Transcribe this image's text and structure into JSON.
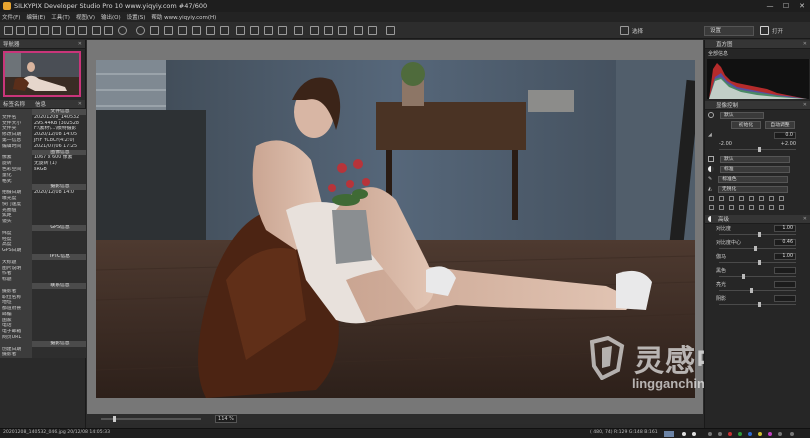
{
  "window": {
    "title": "SILKYPIX Developer Studio Pro 10 www.yiqyiy.com  #47/600",
    "controls": [
      "—",
      "☐",
      "✕"
    ]
  },
  "menu": [
    "文件(F)",
    "编辑(E)",
    "工具(T)",
    "视图(V)",
    "输出(O)",
    "设置(S)",
    "帮助 www.yiqyiy.com(H)"
  ],
  "toolbar": {
    "right_label_1": "选择",
    "right_label_2": "设置",
    "right_label_3": "打开"
  },
  "navigator": {
    "title": "导航器"
  },
  "info": {
    "title_key": "标签名称",
    "title_value": "信息",
    "rows": [
      {
        "k": "",
        "v": "文件信息",
        "sec": true
      },
      {
        "k": "文件名",
        "v": "20201208_140532"
      },
      {
        "k": "文件大小",
        "v": "295.44KB (302528"
      },
      {
        "k": "文件夹",
        "v": "F:\\素材\\...\\模特摄影"
      },
      {
        "k": "修改日期",
        "v": "2020/12/08 14:05"
      },
      {
        "k": "第一信息",
        "v": "JFIF YCbCr(4:2:0)"
      },
      {
        "k": "编辑时间",
        "v": "2021/07/06 17:25"
      },
      {
        "k": "",
        "v": "图像信息",
        "sec": true
      },
      {
        "k": "像素",
        "v": "1067 x 600 像素"
      },
      {
        "k": "旋转",
        "v": "无旋转 (1)"
      },
      {
        "k": "色彩空间",
        "v": "sRGB"
      },
      {
        "k": "量化",
        "v": ""
      },
      {
        "k": "格式",
        "v": ""
      },
      {
        "k": "",
        "v": "摄影信息",
        "sec": true
      },
      {
        "k": "拍摄日期",
        "v": "2020/12/08 14:0"
      },
      {
        "k": "曝光度",
        "v": ""
      },
      {
        "k": "快门速度",
        "v": ""
      },
      {
        "k": "光圈值",
        "v": ""
      },
      {
        "k": "焦距",
        "v": ""
      },
      {
        "k": "镜头",
        "v": ""
      },
      {
        "k": "",
        "v": "GPS信息",
        "sec": true
      },
      {
        "k": "纬度",
        "v": ""
      },
      {
        "k": "经度",
        "v": ""
      },
      {
        "k": "高度",
        "v": ""
      },
      {
        "k": "GPS日期",
        "v": ""
      },
      {
        "k": "",
        "v": "IPTC信息",
        "sec": true
      },
      {
        "k": "大标题",
        "v": ""
      },
      {
        "k": "图片说明",
        "v": ""
      },
      {
        "k": "作者",
        "v": ""
      },
      {
        "k": "标题",
        "v": ""
      },
      {
        "k": "",
        "v": "联系信息",
        "sec": true
      },
      {
        "k": "摄影者",
        "v": ""
      },
      {
        "k": "职位名称",
        "v": ""
      },
      {
        "k": "地址",
        "v": ""
      },
      {
        "k": "都道府县",
        "v": ""
      },
      {
        "k": "邮编",
        "v": ""
      },
      {
        "k": "国家",
        "v": ""
      },
      {
        "k": "电话",
        "v": ""
      },
      {
        "k": "电子邮箱",
        "v": ""
      },
      {
        "k": "网页URL",
        "v": ""
      },
      {
        "k": "",
        "v": "摄影信息",
        "sec": true
      },
      {
        "k": "创建日期",
        "v": ""
      },
      {
        "k": "摄影者",
        "v": ""
      }
    ]
  },
  "viewer": {
    "zoom": "114 %",
    "zoom_fraction": 0.12
  },
  "histogram": {
    "title": "直方图",
    "mode": "全部信息"
  },
  "develop": {
    "title": "显像控制",
    "preset": "默认",
    "btn_auto": "初始化",
    "btn_reset": "自动调整",
    "exposure_value": "0.0",
    "exposure_fraction": 0.5,
    "scale_min": "-2.00",
    "scale_max": "+2.00",
    "wb": "默认",
    "tone": "标准",
    "color": "标准色",
    "sharp": "无锐化"
  },
  "tone": {
    "title": "高级",
    "rows": [
      {
        "label": "对比度",
        "value": "1.00",
        "fraction": 0.5
      },
      {
        "label": "对比度中心",
        "value": "0.46",
        "fraction": 0.46
      },
      {
        "label": "伽马",
        "value": "1.00",
        "fraction": 0.5
      },
      {
        "label": "黑色",
        "value": "",
        "fraction": 0.3
      },
      {
        "label": "亮光",
        "value": "",
        "fraction": 0.4
      },
      {
        "label": "阴影",
        "value": "",
        "fraction": 0.5
      }
    ]
  },
  "status": {
    "left": "20201208_140532_046.jpg 20/12/08 14:05:33",
    "right": "( 480,  74) R:129 G:148 B:161"
  },
  "watermark": {
    "cn": "灵感中国",
    "url": "lingganchina.com"
  },
  "colors": {
    "accent": "#c9357a",
    "panel": "#262626",
    "canvas": "#777777"
  }
}
